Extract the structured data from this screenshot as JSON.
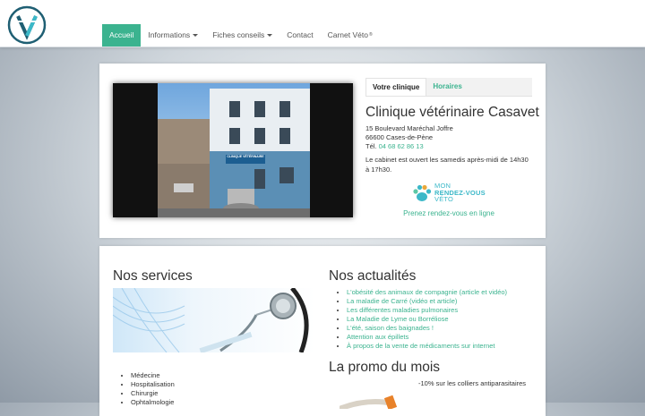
{
  "nav": {
    "items": [
      {
        "label": "Accueil",
        "active": true,
        "dropdown": false
      },
      {
        "label": "Informations",
        "active": false,
        "dropdown": true
      },
      {
        "label": "Fiches conseils",
        "active": false,
        "dropdown": true
      },
      {
        "label": "Contact",
        "active": false,
        "dropdown": false
      },
      {
        "label": "Carnet Véto",
        "active": false,
        "dropdown": false,
        "sup": "®"
      }
    ]
  },
  "clinic": {
    "tabs": [
      "Votre clinique",
      "Horaires"
    ],
    "name": "Clinique vétérinaire Casavet",
    "address_line1": "15 Boulevard Maréchal Joffre",
    "address_line2": "66600 Cases-de-Pène",
    "phone_prefix": "Tél. ",
    "phone": "04 68 62 86 13",
    "hours_note": "Le cabinet est ouvert les samedis après-midi de 14h30 à 17h30.",
    "photo_sign": "CLINIQUE VÉTÉRINAIRE",
    "rdv_logo_line1": "MON",
    "rdv_logo_line2": "RENDEZ-VOUS",
    "rdv_logo_line3": "VÉTO",
    "rdv_link": "Prenez rendez-vous en ligne"
  },
  "services": {
    "title": "Nos services",
    "items": [
      "Médecine",
      "Hospitalisation",
      "Chirurgie",
      "Ophtalmologie"
    ]
  },
  "news": {
    "title": "Nos actualités",
    "items": [
      "L'obésité des animaux de compagnie (article et vidéo)",
      "La maladie de Carré (vidéo et article)",
      "Les différentes maladies pulmonaires",
      "La Maladie de Lyme ou Borréliose",
      "L'été, saison des baignades !",
      "Attention aux épillets",
      "À propos de la vente de médicaments sur internet"
    ]
  },
  "promo": {
    "title": "La promo du mois",
    "text": "-10% sur les colliers antiparasitaires"
  },
  "colors": {
    "accent": "#3bb38f",
    "rdv": "#3bb8c8",
    "logo": "#1f5f73"
  }
}
